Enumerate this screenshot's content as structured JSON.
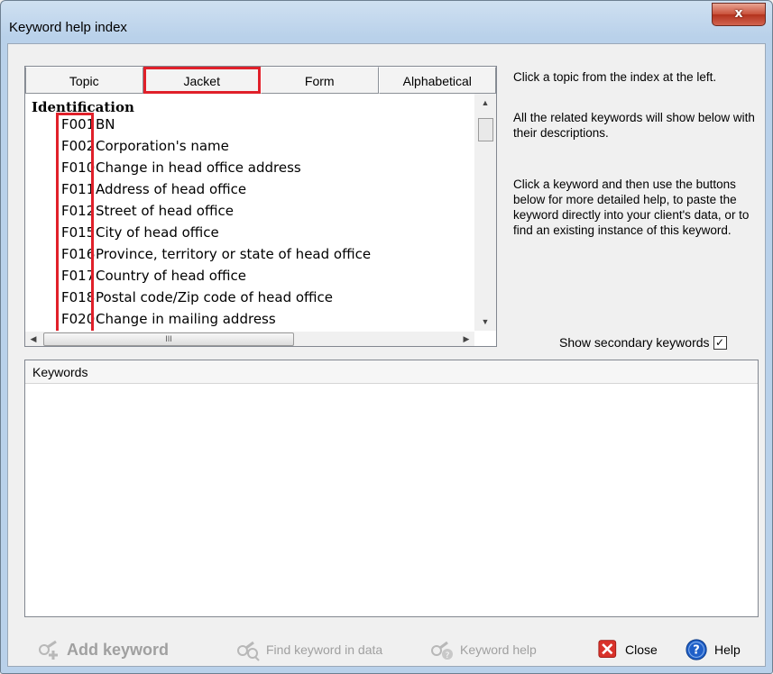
{
  "window": {
    "title": "Keyword help index",
    "close_glyph": "x"
  },
  "tabs": [
    {
      "label": "Topic"
    },
    {
      "label": "Jacket"
    },
    {
      "label": "Form"
    },
    {
      "label": "Alphabetical"
    }
  ],
  "index": {
    "group_title": "Identification",
    "items": [
      {
        "code": "F001",
        "desc": "BN"
      },
      {
        "code": "F002",
        "desc": "Corporation's name"
      },
      {
        "code": "F010",
        "desc": "Change in head office address"
      },
      {
        "code": "F011",
        "desc": "Address of head office"
      },
      {
        "code": "F012",
        "desc": "Street of head office"
      },
      {
        "code": "F015",
        "desc": "City of head office"
      },
      {
        "code": "F016",
        "desc": "Province, territory or state of head office"
      },
      {
        "code": "F017",
        "desc": "Country of head office"
      },
      {
        "code": "F018",
        "desc": "Postal code/Zip code of head office"
      },
      {
        "code": "F020",
        "desc": "Change in mailing address"
      }
    ],
    "scroll_up": "▲",
    "scroll_down": "▼",
    "scroll_left": "◀",
    "scroll_right": "▶",
    "hthumb_grip": "III"
  },
  "help": {
    "line1": "Click a topic from the index at the left.",
    "line2": "All the related keywords will show below with their descriptions.",
    "line3": "Click a keyword and then use the buttons below for more detailed help, to paste the keyword directly into your client's data, or to find an existing instance of this keyword."
  },
  "secondary": {
    "label": "Show secondary keywords",
    "checked": true,
    "check_glyph": "✓"
  },
  "keywords": {
    "header": "Keywords"
  },
  "buttons": {
    "add_keyword": "Add keyword",
    "find_keyword": "Find keyword in data",
    "keyword_help": "Keyword help",
    "close": "Close",
    "help": "Help"
  },
  "colors": {
    "highlight": "#e0202a",
    "close_red": "#d9322a",
    "help_blue": "#1f5fc8"
  }
}
